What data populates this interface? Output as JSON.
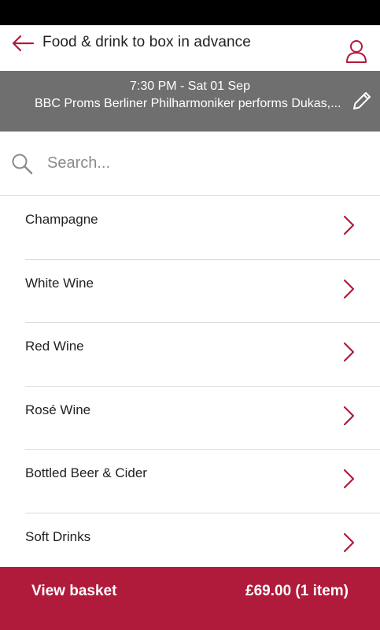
{
  "colors": {
    "accent": "#b01a3b",
    "banner": "#6f6f6f",
    "status_bar": "#000000",
    "divider": "#dcdcdc"
  },
  "header": {
    "title": "Food & drink to box in advance",
    "back_icon": "arrow-left-icon",
    "account_icon": "user-icon"
  },
  "event": {
    "time": "7:30 PM - Sat 01 Sep",
    "name": "BBC Proms Berliner Philharmoniker performs Dukas,...",
    "edit_icon": "pencil-icon"
  },
  "search": {
    "placeholder": "Search...",
    "value": "",
    "icon": "search-icon"
  },
  "categories": [
    {
      "label": "Champagne"
    },
    {
      "label": "White Wine"
    },
    {
      "label": "Red Wine"
    },
    {
      "label": "Rosé Wine"
    },
    {
      "label": "Bottled Beer & Cider"
    },
    {
      "label": "Soft Drinks"
    }
  ],
  "basket": {
    "label": "View basket",
    "total": "£69.00 (1 item)"
  }
}
